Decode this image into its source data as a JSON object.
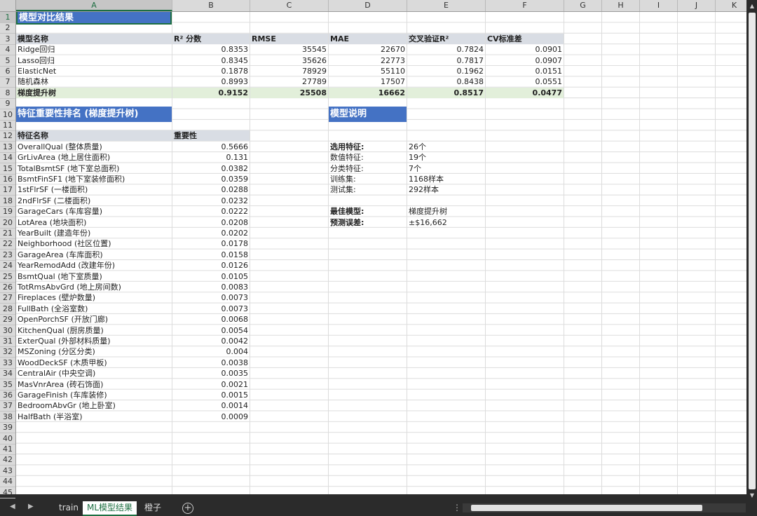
{
  "columns": [
    "A",
    "B",
    "C",
    "D",
    "E",
    "F",
    "G",
    "H",
    "I",
    "J",
    "K"
  ],
  "rows": [
    "1",
    "2",
    "3",
    "4",
    "5",
    "6",
    "7",
    "8",
    "9",
    "10",
    "11",
    "12",
    "13",
    "14",
    "15",
    "16",
    "17",
    "18",
    "19",
    "20",
    "21",
    "22",
    "23",
    "24",
    "25",
    "26",
    "27",
    "28",
    "29",
    "30",
    "31",
    "32",
    "33",
    "34",
    "35",
    "36",
    "37",
    "38",
    "39",
    "40",
    "41",
    "42",
    "43",
    "44",
    "45"
  ],
  "title1": "模型对比结果",
  "model_table": {
    "headers": [
      "模型名称",
      "R² 分数",
      "RMSE",
      "MAE",
      "交叉验证R²",
      "CV标准差"
    ],
    "rows": [
      [
        "Ridge回归",
        "0.8353",
        "35545",
        "22670",
        "0.7824",
        "0.0901"
      ],
      [
        "Lasso回归",
        "0.8345",
        "35626",
        "22773",
        "0.7817",
        "0.0907"
      ],
      [
        "ElasticNet",
        "0.1878",
        "78929",
        "55110",
        "0.1962",
        "0.0151"
      ],
      [
        "随机森林",
        "0.8993",
        "27789",
        "17507",
        "0.8438",
        "0.0551"
      ],
      [
        "梯度提升树",
        "0.9152",
        "25508",
        "16662",
        "0.8517",
        "0.0477"
      ]
    ]
  },
  "title2": "特征重要性排名 (梯度提升树)",
  "feature_table": {
    "headers": [
      "特征名称",
      "重要性"
    ],
    "rows": [
      [
        "OverallQual (整体质量)",
        "0.5666"
      ],
      [
        "GrLivArea (地上居住面积)",
        "0.131"
      ],
      [
        "TotalBsmtSF (地下室总面积)",
        "0.0382"
      ],
      [
        "BsmtFinSF1 (地下室装修面积)",
        "0.0359"
      ],
      [
        "1stFlrSF (一楼面积)",
        "0.0288"
      ],
      [
        "2ndFlrSF (二楼面积)",
        "0.0232"
      ],
      [
        "GarageCars (车库容量)",
        "0.0222"
      ],
      [
        "LotArea (地块面积)",
        "0.0208"
      ],
      [
        "YearBuilt (建造年份)",
        "0.0202"
      ],
      [
        "Neighborhood (社区位置)",
        "0.0178"
      ],
      [
        "GarageArea (车库面积)",
        "0.0158"
      ],
      [
        "YearRemodAdd (改建年份)",
        "0.0126"
      ],
      [
        "BsmtQual (地下室质量)",
        "0.0105"
      ],
      [
        "TotRmsAbvGrd (地上房间数)",
        "0.0083"
      ],
      [
        "Fireplaces (壁炉数量)",
        "0.0073"
      ],
      [
        "FullBath (全浴室数)",
        "0.0073"
      ],
      [
        "OpenPorchSF (开放门廊)",
        "0.0068"
      ],
      [
        "KitchenQual (厨房质量)",
        "0.0054"
      ],
      [
        "ExterQual (外部材料质量)",
        "0.0042"
      ],
      [
        "MSZoning (分区分类)",
        "0.004"
      ],
      [
        "WoodDeckSF (木质甲板)",
        "0.0038"
      ],
      [
        "CentralAir (中央空调)",
        "0.0035"
      ],
      [
        "MasVnrArea (砖石饰面)",
        "0.0021"
      ],
      [
        "GarageFinish (车库装修)",
        "0.0015"
      ],
      [
        "BedroomAbvGr (地上卧室)",
        "0.0014"
      ],
      [
        "HalfBath (半浴室)",
        "0.0009"
      ]
    ]
  },
  "title3": "模型说明",
  "model_info": [
    [
      "选用特征:",
      "26个"
    ],
    [
      "数值特征:",
      "19个"
    ],
    [
      "分类特征:",
      "7个"
    ],
    [
      "训练集:",
      "1168样本"
    ],
    [
      "测试集:",
      "292样本"
    ],
    [
      "",
      ""
    ],
    [
      "最佳模型:",
      "梯度提升树"
    ],
    [
      "预测误差:",
      "±$16,662"
    ]
  ],
  "tabs": [
    "train",
    "ML模型结果",
    "橙子"
  ],
  "active_tab_index": 1,
  "colors": {
    "title_bg": "#4472c4",
    "header_bg": "#d9dde4",
    "best_row_bg": "#e2efda",
    "accent": "#1d6f42"
  }
}
